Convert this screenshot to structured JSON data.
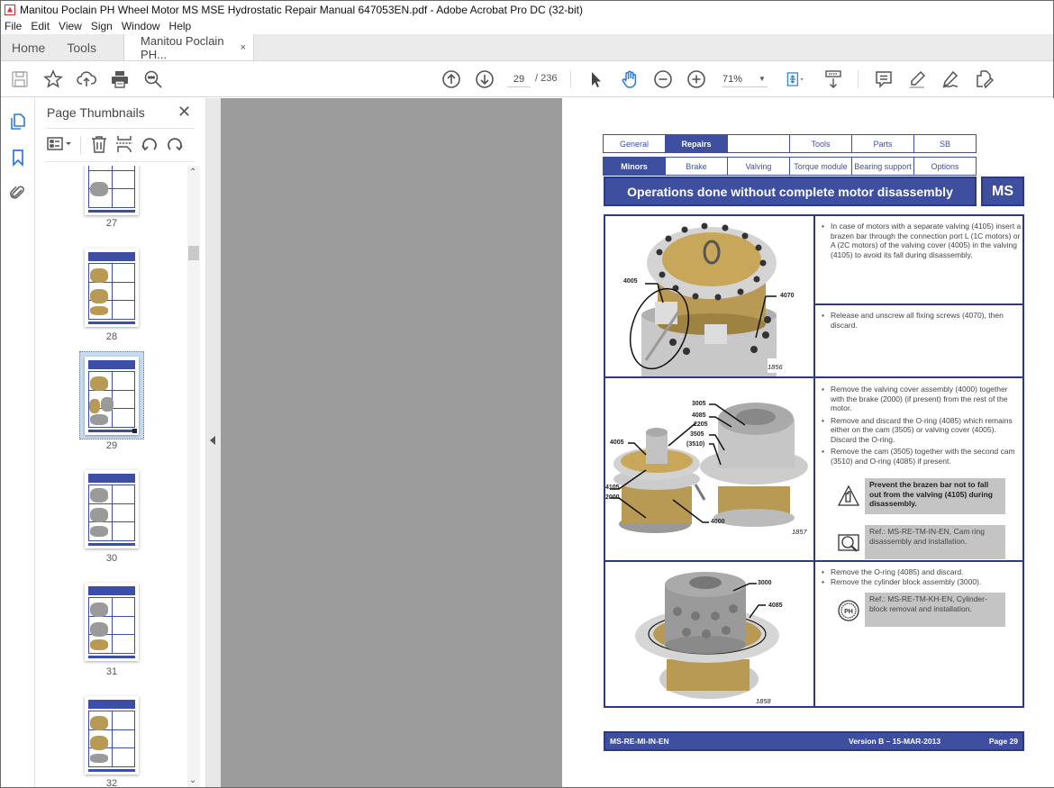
{
  "window": {
    "title": "Manitou Poclain PH Wheel Motor MS MSE Hydrostatic Repair Manual 647053EN.pdf - Adobe Acrobat Pro DC (32-bit)"
  },
  "menu": [
    "File",
    "Edit",
    "View",
    "Sign",
    "Window",
    "Help"
  ],
  "tabs": {
    "home": "Home",
    "tools": "Tools",
    "document": "Manitou Poclain PH...",
    "close_glyph": "×"
  },
  "toolbar": {
    "icons": [
      "save-icon",
      "bookmark-star-icon",
      "cloud-upload-icon",
      "print-icon",
      "find-icon",
      "prev-page-icon",
      "next-page-icon",
      "select-cursor-icon",
      "hand-tool-icon",
      "zoom-out-icon",
      "zoom-in-icon",
      "fit-page-icon",
      "scroll-mode-icon",
      "comment-icon",
      "highlight-icon",
      "sign-icon",
      "share-icon"
    ],
    "current_page": "29",
    "total_pages": "/ 236",
    "zoom": "71%",
    "active_color": "#2b7bd4"
  },
  "left_rail": {
    "icons": [
      "page-thumbnails-icon",
      "bookmarks-icon",
      "attachments-icon"
    ]
  },
  "thumbnails_panel": {
    "title": "Page Thumbnails",
    "close_glyph": "✕",
    "tools": [
      "thumbnail-options-icon",
      "delete-page-icon",
      "insert-page-icon",
      "rotate-left-icon",
      "rotate-right-icon"
    ],
    "pages": [
      {
        "number": "27",
        "selected": false
      },
      {
        "number": "28",
        "selected": false
      },
      {
        "number": "29",
        "selected": true
      },
      {
        "number": "30",
        "selected": false
      },
      {
        "number": "31",
        "selected": false
      },
      {
        "number": "32",
        "selected": false
      }
    ]
  },
  "pdf_page": {
    "nav_row1": [
      "General",
      "Repairs",
      "",
      "Tools",
      "Parts",
      "SB"
    ],
    "nav_row1_active": "Repairs",
    "nav_row2": [
      "Minors",
      "Brake",
      "Valving",
      "Torque module",
      "Bearing support",
      "Options"
    ],
    "nav_row2_active": "Minors",
    "banner": "Operations done without complete motor disassembly",
    "badge": "MS",
    "sections": [
      {
        "figure_id": "1856",
        "labels": [
          "4005",
          "4070"
        ],
        "steps_a": [
          "In case of motors with a separate valving (4105) insert a brazen bar through the connection port L (1C motors) or A (2C motors) of the valving cover (4005) in the valving (4105) to avoid its fall during disassembly."
        ],
        "steps_b": [
          "Release and unscrew all fixing screws (4070), then discard."
        ]
      },
      {
        "figure_id": "1857",
        "labels": [
          "3005",
          "4085",
          "2205",
          "3505",
          "(3510)",
          "4005",
          "4105",
          "2000",
          "4000"
        ],
        "steps": [
          "Remove the valving cover assembly (4000) together with the brake (2000) (if present) from the rest of the motor.",
          "Remove and discard the O-ring (4085) which remains either on the cam (3505) or valving cover (4005). Discard the O-ring.",
          "Remove the cam (3505) together with the second cam (3510) and O-ring (4085) if present."
        ],
        "warning": "Prevent the brazen bar not to fall out from the valving (4105) during disassembly.",
        "reference": "Ref.: MS-RE-TM-IN-EN, Cam ring disassembly and installation."
      },
      {
        "figure_id": "1858",
        "labels": [
          "3000",
          "4085"
        ],
        "steps": [
          "Remove the O-ring (4085) and discard.",
          "Remove the cylinder block assembly (3000)."
        ],
        "reference": "Ref.: MS-RE-TM-KH-EN, Cylinder-block removal and installation."
      }
    ],
    "footer": {
      "doc_code": "MS-RE-MI-IN-EN",
      "version": "Version B – 15-MAR-2013",
      "page": "Page 29"
    },
    "colors": {
      "primary": "#3f4fa0",
      "border": "#2e3a80",
      "note_bg": "#c4c4c4",
      "metal_gold": "#b89a55"
    }
  }
}
